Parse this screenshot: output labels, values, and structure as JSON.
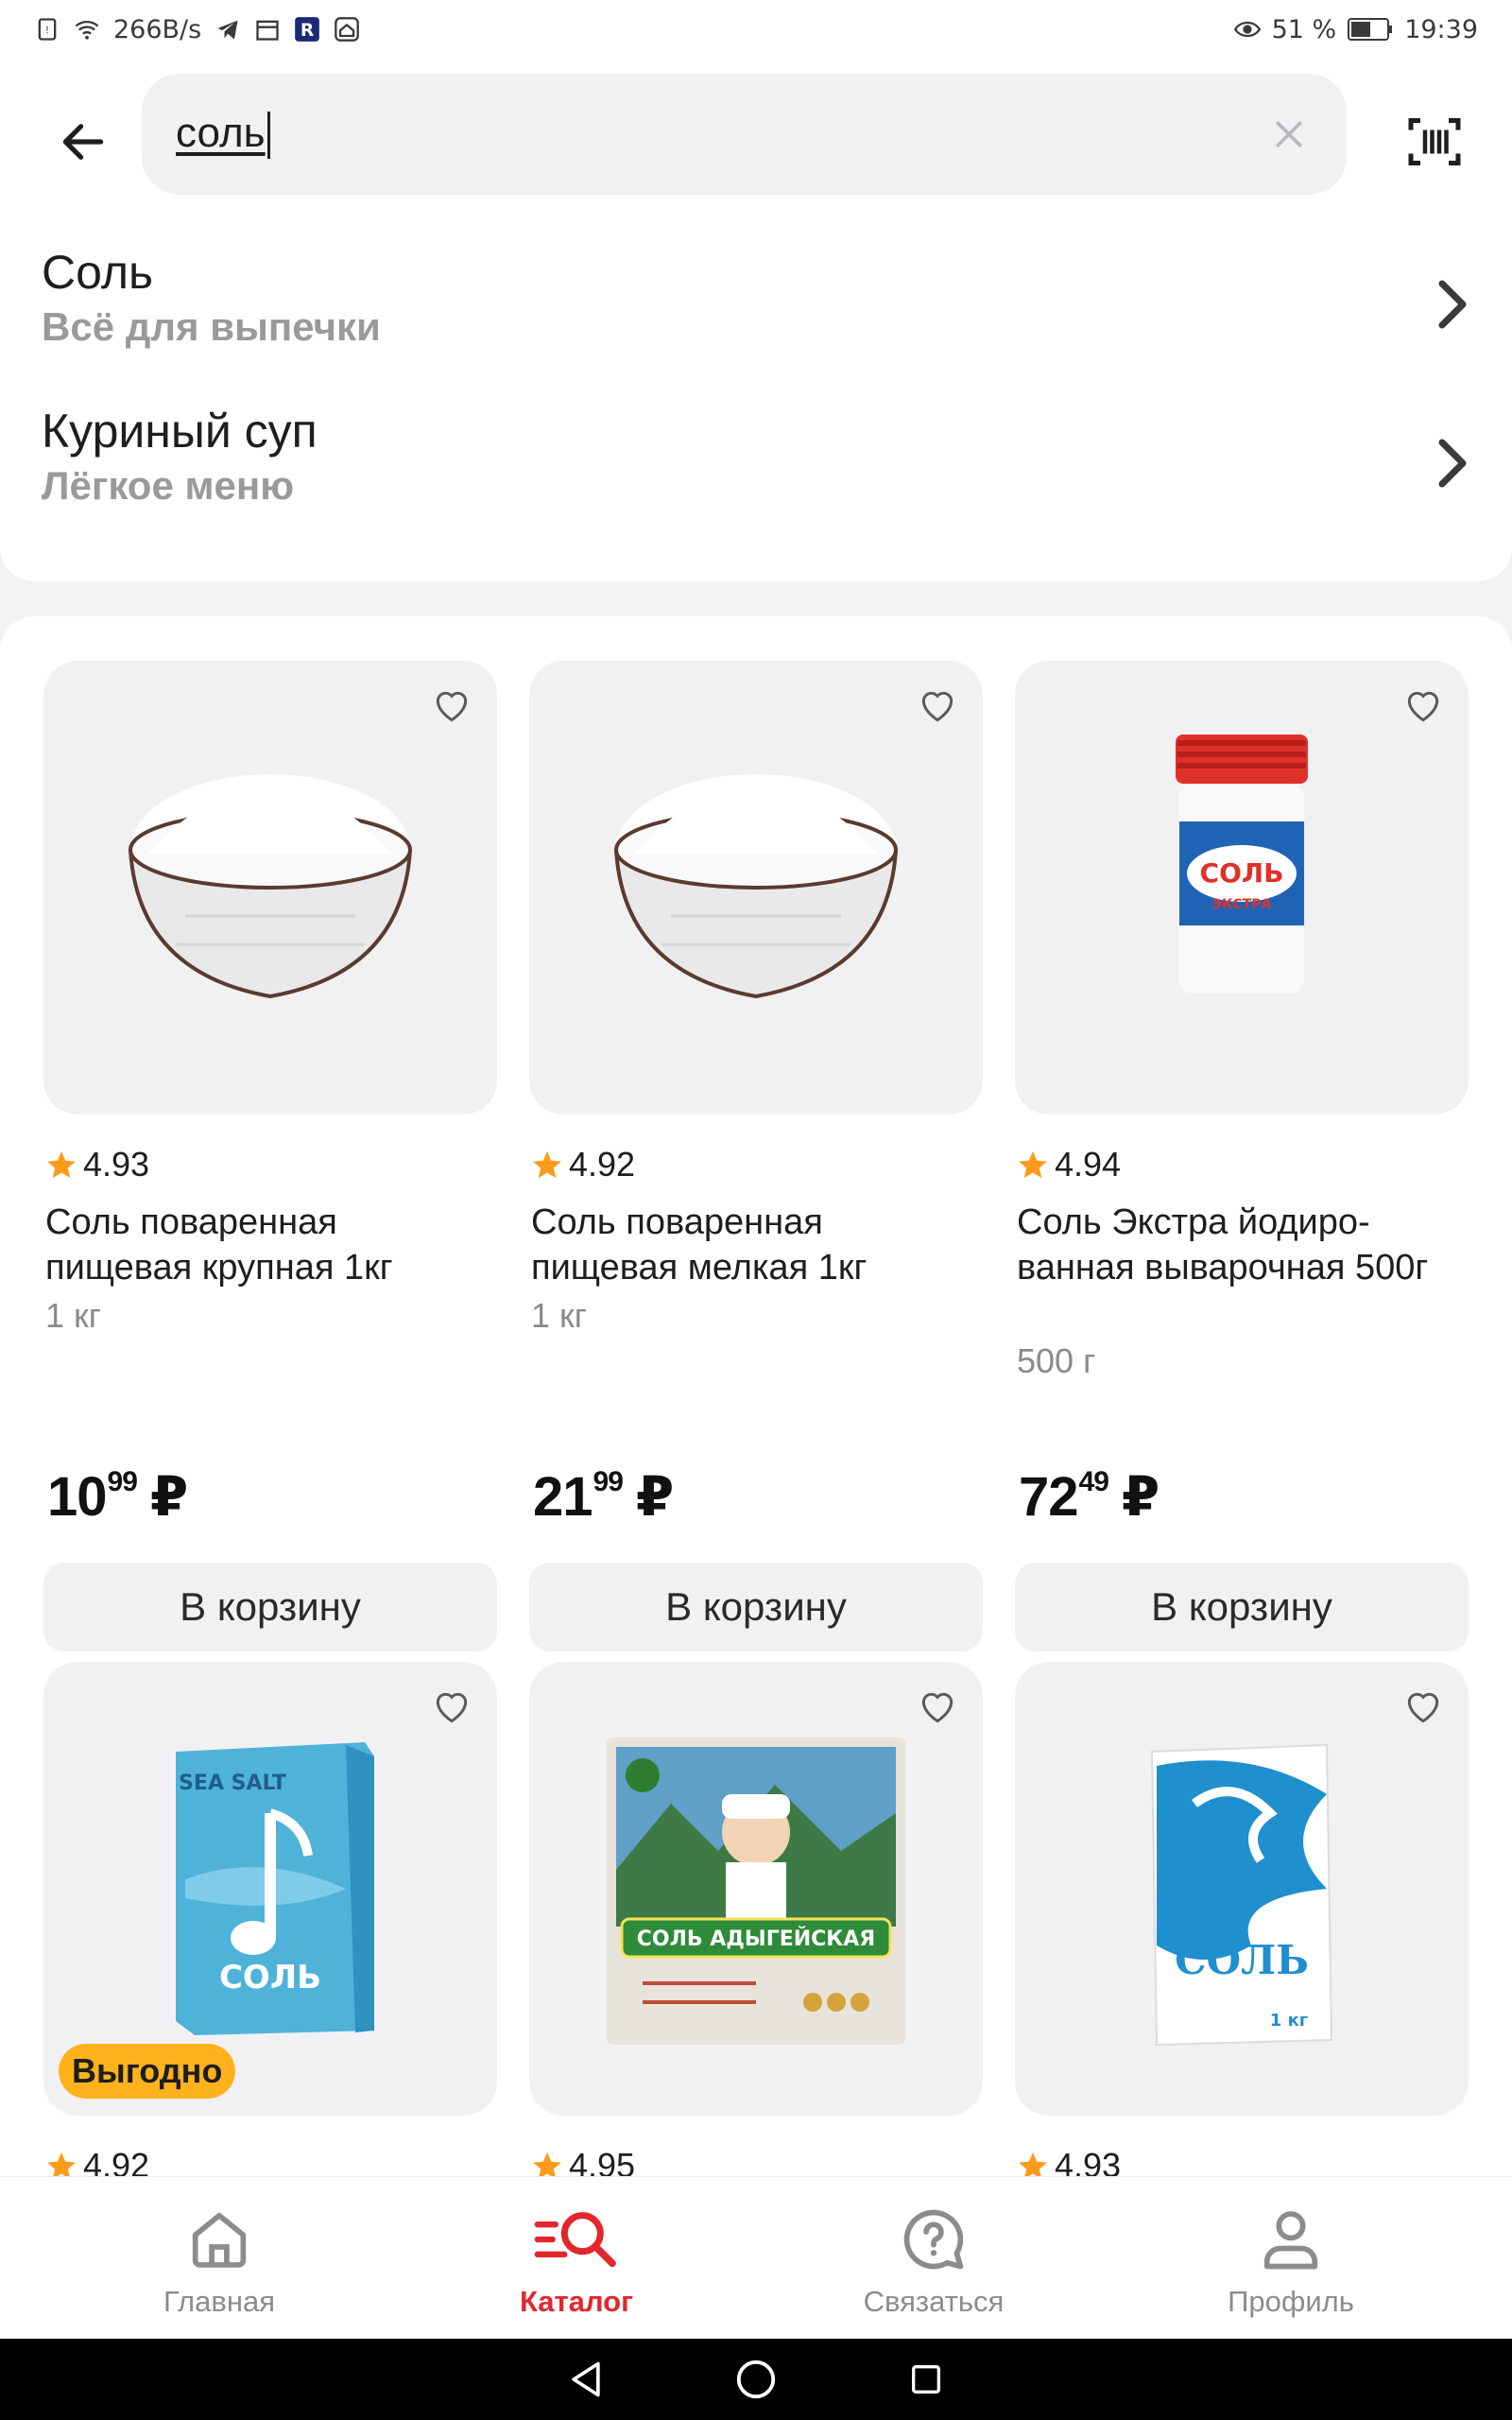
{
  "status_bar": {
    "net_speed": "266B/s",
    "battery": "51 %",
    "time": "19:39"
  },
  "search": {
    "value": "соль"
  },
  "suggestions": [
    {
      "title": "Соль",
      "subtitle": "Всё для выпечки"
    },
    {
      "title": "Куриный суп",
      "subtitle": "Лёгкое меню"
    }
  ],
  "products": [
    {
      "rating": "4.93",
      "name": "Соль поваренная пищевая крупная 1кг",
      "weight": "1 кг",
      "price_int": "10",
      "price_frac": "99",
      "currency": "₽",
      "cart_label": "В корзину",
      "image": "salt-bowl"
    },
    {
      "rating": "4.92",
      "name": "Соль поваренная пищевая мелкая 1кг",
      "weight": "1 кг",
      "price_int": "21",
      "price_frac": "99",
      "currency": "₽",
      "cart_label": "В корзину",
      "image": "salt-bowl"
    },
    {
      "rating": "4.94",
      "name": "Соль Экстра йодиро-ванная выварочная 500г",
      "weight": "500 г",
      "price_int": "72",
      "price_frac": "49",
      "currency": "₽",
      "cart_label": "В корзину",
      "image": "salt-jar",
      "jar_label": "СОЛЬ",
      "jar_sub": "ЭКСТРА"
    },
    {
      "rating": "4.92",
      "badge": "Выгодно",
      "image": "sea-salt-box",
      "box_title": "SEA SALT",
      "box_label": "СОЛЬ"
    },
    {
      "rating": "4.95",
      "image": "adyghe-salt-pack",
      "pack_label": "СОЛЬ АДЫГЕЙСКАЯ"
    },
    {
      "rating": "4.93",
      "image": "salt-carton",
      "carton_label": "СОЛЬ",
      "carton_weight": "1 кг"
    }
  ],
  "bottom_nav": [
    {
      "label": "Главная",
      "icon": "home-icon"
    },
    {
      "label": "Каталог",
      "icon": "catalog-search-icon",
      "active": true
    },
    {
      "label": "Связаться",
      "icon": "help-chat-icon"
    },
    {
      "label": "Профиль",
      "icon": "profile-icon"
    }
  ],
  "colors": {
    "accent": "#e3262d",
    "badge": "#ffb21c",
    "star": "#ff9a1a",
    "card_bg": "#f1f1f3"
  }
}
